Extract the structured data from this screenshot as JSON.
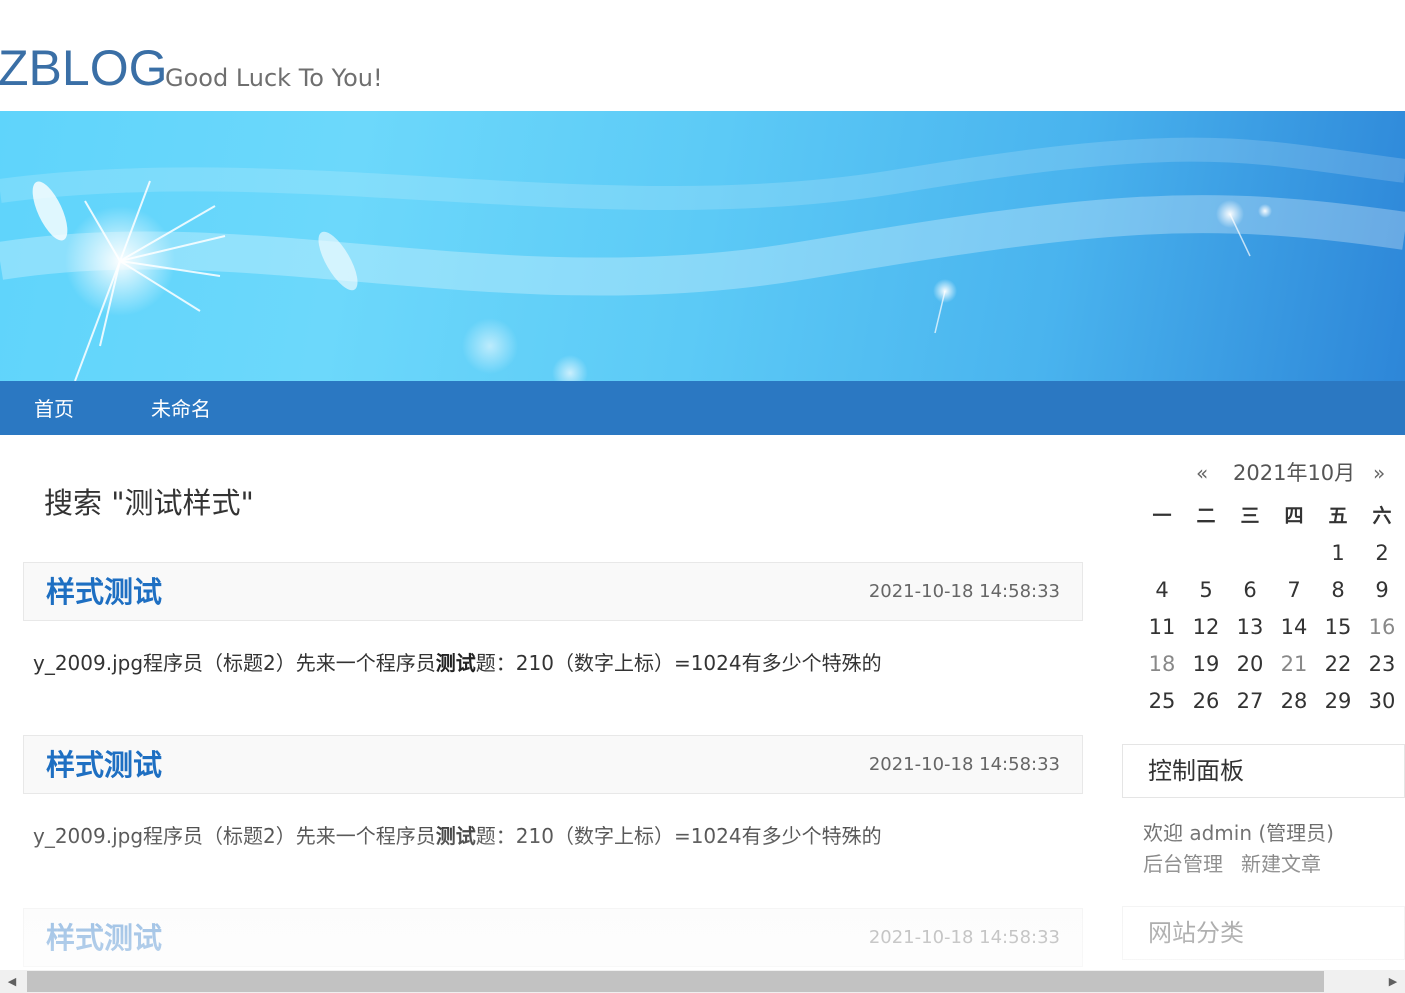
{
  "site": {
    "title": "ZBLOG",
    "subtitle": "Good Luck To You!"
  },
  "nav": {
    "items": [
      {
        "label": "首页"
      },
      {
        "label": "未命名"
      }
    ]
  },
  "search": {
    "heading": "搜索 \"测试样式\""
  },
  "posts": [
    {
      "title": "样式测试",
      "date": "2021-10-18 14:58:33",
      "excerpt_pre": "y_2009.jpg程序员（标题2）先来一个程序员",
      "excerpt_bold": "测试",
      "excerpt_post": "题：210（数字上标）=1024有多少个特殊的"
    },
    {
      "title": "样式测试",
      "date": "2021-10-18 14:58:33",
      "excerpt_pre": "y_2009.jpg程序员（标题2）先来一个程序员",
      "excerpt_bold": "测试",
      "excerpt_post": "题：210（数字上标）=1024有多少个特殊的"
    },
    {
      "title": "样式测试",
      "date": "2021-10-18 14:58:33"
    }
  ],
  "calendar": {
    "prev": "«",
    "next": "»",
    "title": "2021年10月",
    "weekdays": [
      "一",
      "二",
      "三",
      "四",
      "五",
      "六"
    ],
    "rows": [
      [
        "",
        "",
        "",
        "",
        "1",
        "2"
      ],
      [
        "4",
        "5",
        "6",
        "7",
        "8",
        "9"
      ],
      [
        "11",
        "12",
        "13",
        "14",
        "15",
        "16"
      ],
      [
        "18",
        "19",
        "20",
        "21",
        "22",
        "23"
      ],
      [
        "25",
        "26",
        "27",
        "28",
        "29",
        "30"
      ]
    ]
  },
  "control_panel": {
    "title": "控制面板",
    "welcome": "欢迎 admin (管理员)",
    "admin_link": "后台管理",
    "new_post_link": "新建文章"
  },
  "categories": {
    "title": "网站分类"
  },
  "scrollbar": {
    "left_arrow": "◀",
    "right_arrow": "▶"
  }
}
